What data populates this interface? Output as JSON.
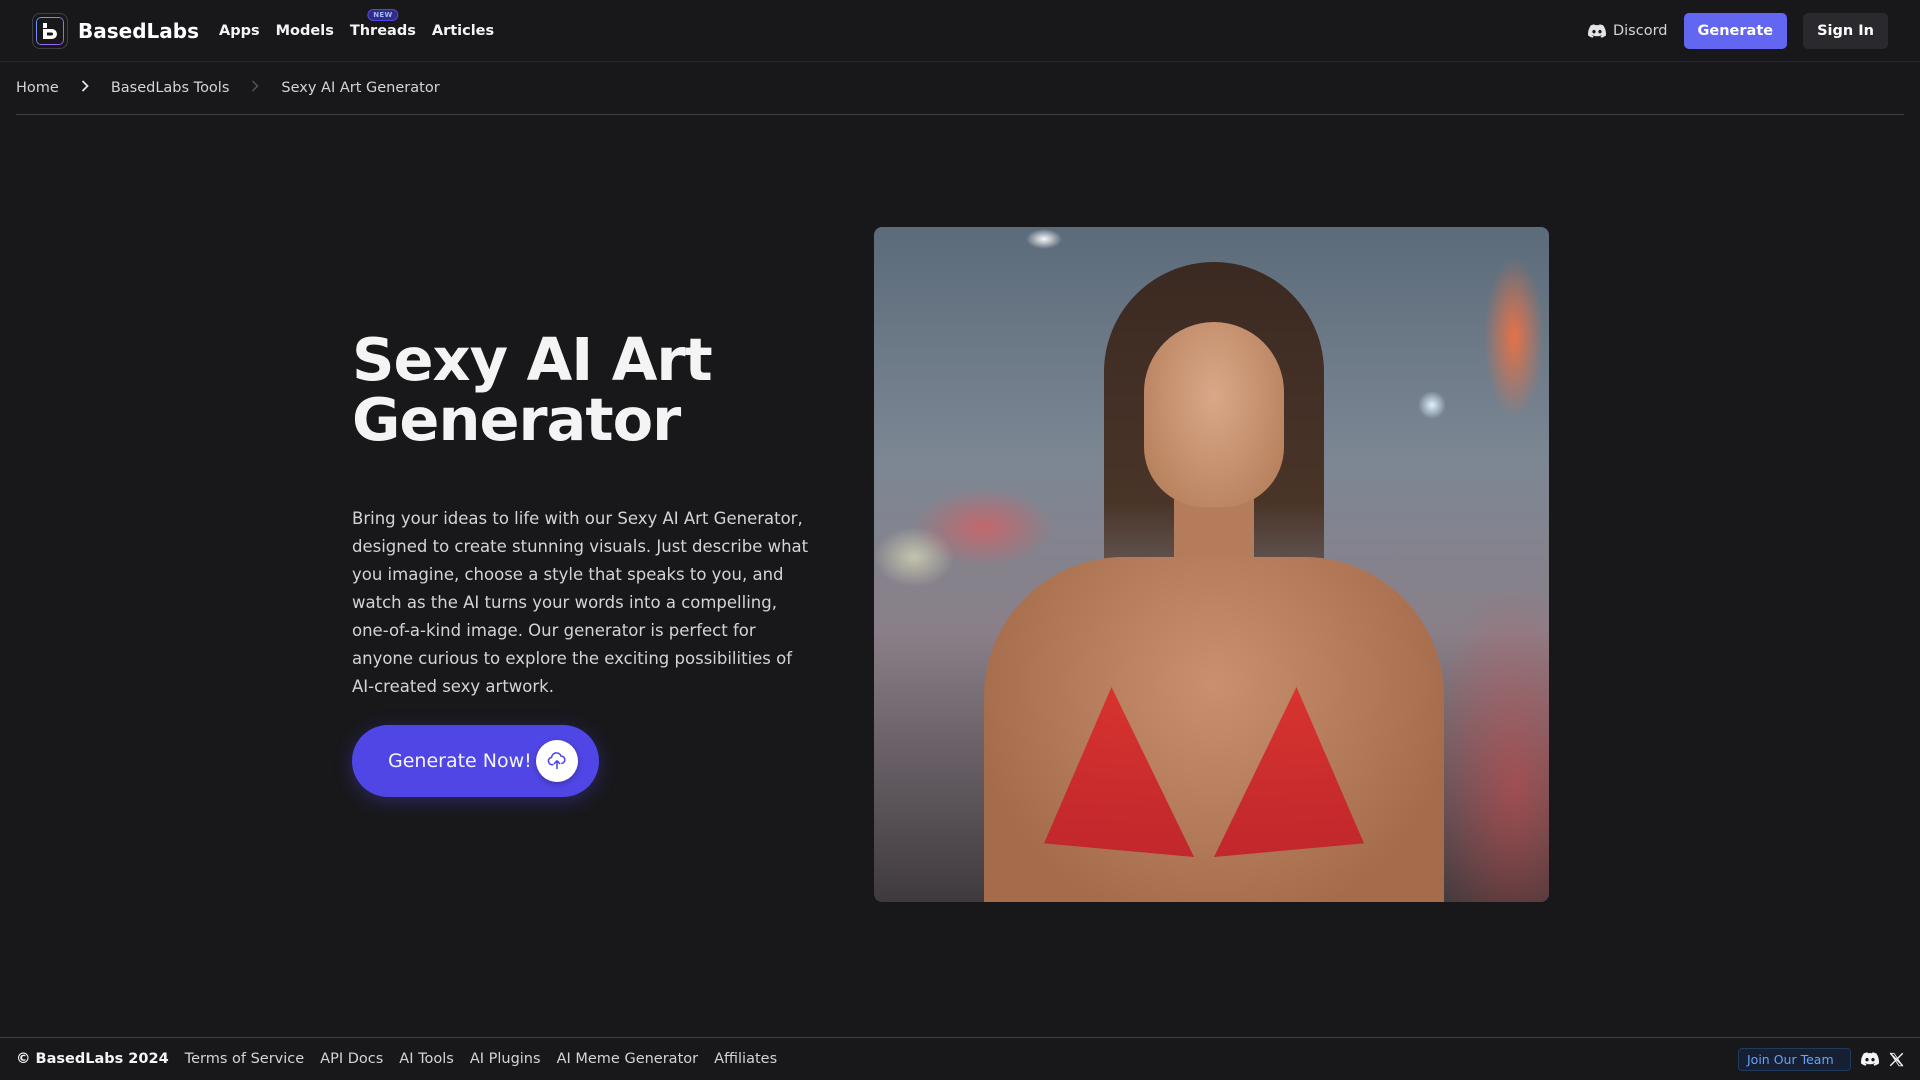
{
  "header": {
    "brand": "BasedLabs",
    "nav": [
      {
        "label": "Apps"
      },
      {
        "label": "Models"
      },
      {
        "label": "Threads",
        "badge": "NEW"
      },
      {
        "label": "Articles"
      }
    ],
    "discord_label": "Discord",
    "generate_label": "Generate",
    "signin_label": "Sign In"
  },
  "breadcrumb": {
    "items": [
      "Home",
      "BasedLabs Tools",
      "Sexy AI Art Generator"
    ]
  },
  "hero": {
    "title_line1": "Sexy AI Art",
    "title_line2": "Generator",
    "description": "Bring your ideas to life with our Sexy AI Art Generator, designed to create stunning visuals. Just describe what you imagine, choose a style that speaks to you, and watch as the AI turns your words into a compelling, one-of-a-kind image. Our generator is perfect for anyone curious to explore the exciting possibilities of AI-created sexy artwork.",
    "cta_label": "Generate Now!",
    "cta_icon": "cloud-upload-icon",
    "image_alt": "AI-generated portrait of a woman in a red bikini top on a foggy neon-lit city street at night"
  },
  "footer": {
    "copyright": "© BasedLabs 2024",
    "links": [
      "Terms of Service",
      "API Docs",
      "AI Tools",
      "AI Plugins",
      "AI Meme Generator",
      "Affiliates"
    ],
    "join_team_label": "Join Our Team",
    "social_icons": [
      "discord-icon",
      "x-icon"
    ]
  },
  "colors": {
    "background": "#18181b",
    "accent": "#6366f1",
    "cta": "#4f46e5",
    "secondary_button": "#2a2a2e",
    "join_team_text": "#60a5fa"
  }
}
